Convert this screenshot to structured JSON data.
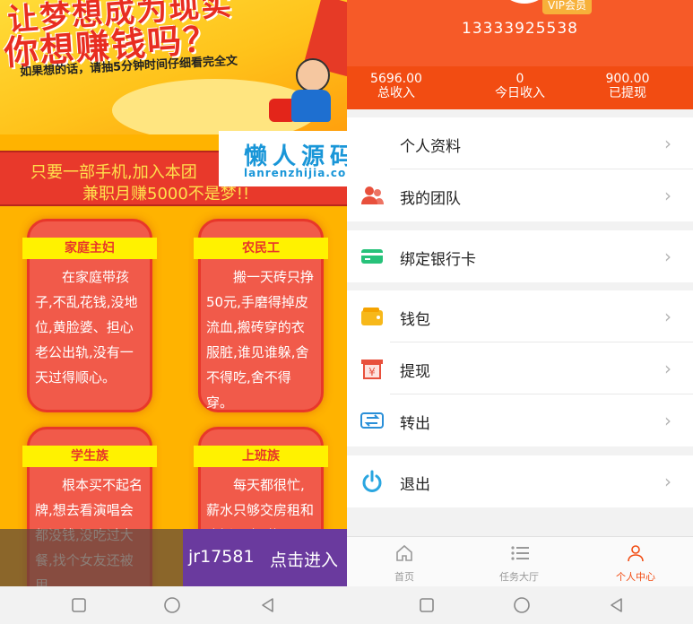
{
  "left": {
    "banner": {
      "line1": "让梦想成为现实",
      "line2": "你想赚钱吗？",
      "subtitle": "如果想的话，请抽5分钟时间仔细看完全文"
    },
    "tagline": {
      "line1": "只要一部手机,加入本团",
      "line2": "兼职月赚5000不是梦!!"
    },
    "watermark": {
      "main": "懒人源码",
      "sub": "lanrenzhijia.com"
    },
    "cards": [
      {
        "title": "家庭主妇",
        "text": "在家庭带孩子,不乱花钱,没地位,黄脸婆、担心老公出轨,没有一天过得顺心。"
      },
      {
        "title": "农民工",
        "text": "搬一天砖只挣50元,手磨得掉皮流血,搬砖穿的衣服脏,谁见谁躲,舍不得吃,舍不得穿。"
      },
      {
        "title": "学生族",
        "text": "根本买不起名牌,想去看演唱会都没钱,没吃过大餐,找个女友还被甩。"
      },
      {
        "title": "上班族",
        "text": "每天都很忙,薪水只够交房租和吃饭,不知道以"
      }
    ],
    "cta": {
      "code": "jr17581",
      "enter": "点击进入"
    }
  },
  "right": {
    "profile": {
      "vip": "VIP会员",
      "phone": "13333925538"
    },
    "stats": [
      {
        "value": "5696.00",
        "label": "总收入"
      },
      {
        "value": "0",
        "label": "今日收入"
      },
      {
        "value": "900.00",
        "label": "已提现"
      }
    ],
    "menu": [
      {
        "label": "个人资料",
        "icon": "user-icon"
      },
      {
        "label": "我的团队",
        "icon": "team-icon"
      },
      {
        "label": "绑定银行卡",
        "icon": "bank-card-icon"
      },
      {
        "label": "钱包",
        "icon": "wallet-icon"
      },
      {
        "label": "提现",
        "icon": "withdraw-icon"
      },
      {
        "label": "转出",
        "icon": "transfer-icon"
      },
      {
        "label": "退出",
        "icon": "power-icon"
      }
    ],
    "chevron": "›",
    "tabs": [
      {
        "label": "首页",
        "icon": "home-icon"
      },
      {
        "label": "任务大厅",
        "icon": "task-list-icon"
      },
      {
        "label": "个人中心",
        "icon": "person-icon"
      }
    ],
    "colors": {
      "accent": "#f24c12",
      "header": "#f65a28"
    }
  }
}
